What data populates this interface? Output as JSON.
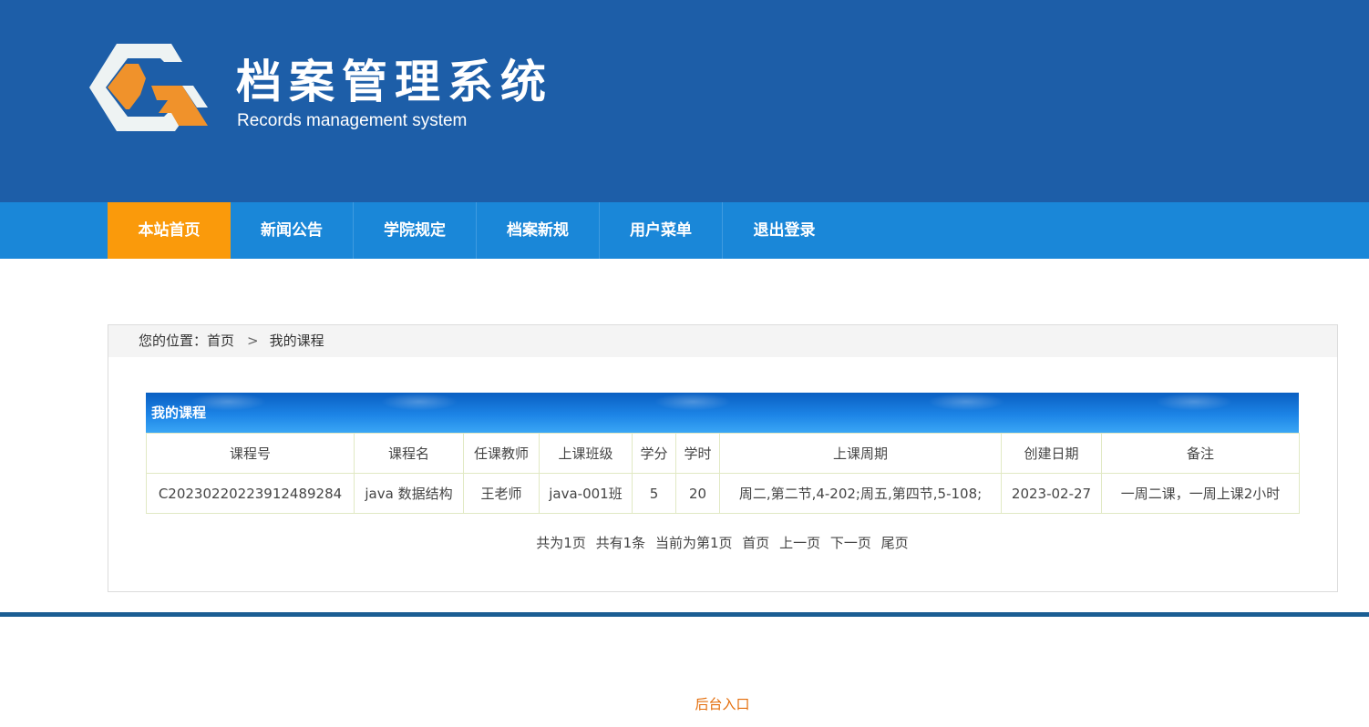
{
  "header": {
    "title": "档案管理系统",
    "subtitle": "Records management system",
    "brand_color": "#1d5ea8",
    "logo_accent": "#f0922b"
  },
  "nav": {
    "items": [
      {
        "label": "本站首页",
        "active": true
      },
      {
        "label": "新闻公告"
      },
      {
        "label": "学院规定"
      },
      {
        "label": "档案新规"
      },
      {
        "label": "用户菜单"
      },
      {
        "label": "退出登录"
      }
    ]
  },
  "breadcrumb": {
    "prefix": "您的位置：",
    "home": "首页",
    "separator": ">",
    "current": "我的课程"
  },
  "course_table": {
    "title": "我的课程",
    "columns": [
      "课程号",
      "课程名",
      "任课教师",
      "上课班级",
      "学分",
      "学时",
      "上课周期",
      "创建日期",
      "备注"
    ],
    "rows": [
      [
        "C20230220223912489284",
        "java 数据结构",
        "王老师",
        "java-001班",
        "5",
        "20",
        "周二,第二节,4-202;周五,第四节,5-108;",
        "2023-02-27",
        "一周二课，一周上课2小时"
      ]
    ]
  },
  "pager": {
    "total_pages": "共为1页",
    "total_items": "共有1条",
    "current_page": "当前为第1页",
    "first": "首页",
    "prev": "上一页",
    "next": "下一页",
    "last": "尾页"
  },
  "footer": {
    "admin_link": "后台入口",
    "link_color": "#e36c09"
  }
}
